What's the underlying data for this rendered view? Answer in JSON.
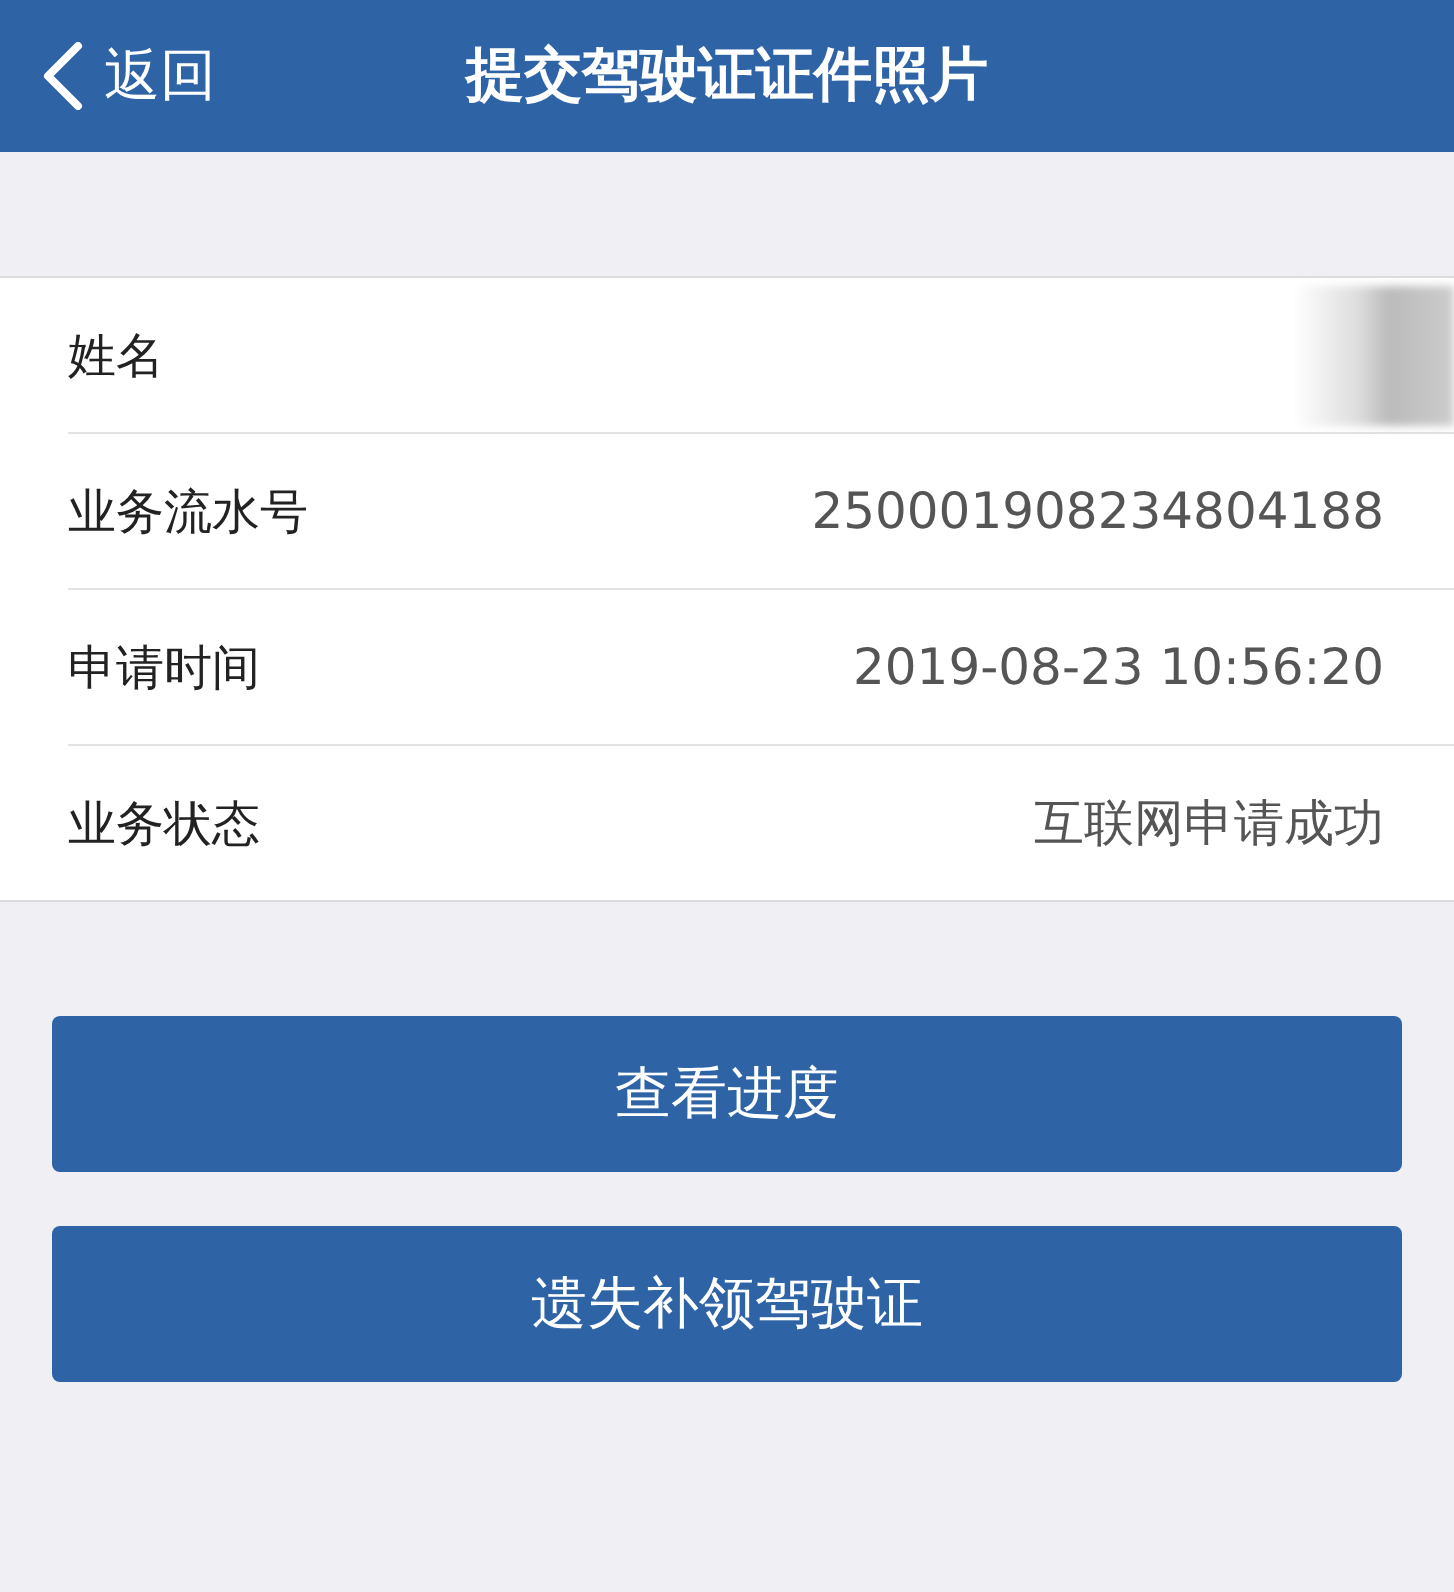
{
  "nav_bar": {
    "back_label": "返回",
    "title": "提交驾驶证证件照片"
  },
  "details": [
    {
      "label": "姓名",
      "kind": "redacted"
    },
    {
      "label": "业务流水号",
      "value": "250001908234804188",
      "kind": "text"
    },
    {
      "label": "申请时间",
      "value": "2019-08-23 10:56:20",
      "kind": "text"
    },
    {
      "label": "业务状态",
      "value": "互联网申请成功",
      "kind": "text"
    }
  ],
  "buttons": [
    "查看进度",
    "遗失补领驾驶证"
  ]
}
